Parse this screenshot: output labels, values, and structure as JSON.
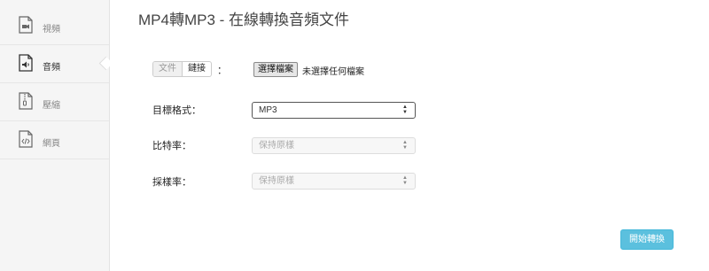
{
  "sidebar": {
    "items": [
      {
        "label": "視頻",
        "icon": "video-file-icon"
      },
      {
        "label": "音頻",
        "icon": "audio-file-icon",
        "active": true
      },
      {
        "label": "壓縮",
        "icon": "archive-file-icon"
      },
      {
        "label": "網頁",
        "icon": "code-file-icon"
      }
    ]
  },
  "main": {
    "title": "MP4轉MP3 - 在線轉換音頻文件",
    "source_toggle": {
      "file": "文件",
      "link": "鏈接",
      "colon": "："
    },
    "file_input": {
      "button": "選擇檔案",
      "status": "未選擇任何檔案"
    },
    "target_format": {
      "label": "目標格式：",
      "value": "MP3"
    },
    "bitrate": {
      "label": "比特率：",
      "value": "保持原樣"
    },
    "sample_rate": {
      "label": "採樣率：",
      "value": "保持原樣"
    },
    "convert_button": "開始轉換"
  },
  "colors": {
    "accent": "#5bc0de",
    "sidebar_bg": "#f5f5f5"
  }
}
